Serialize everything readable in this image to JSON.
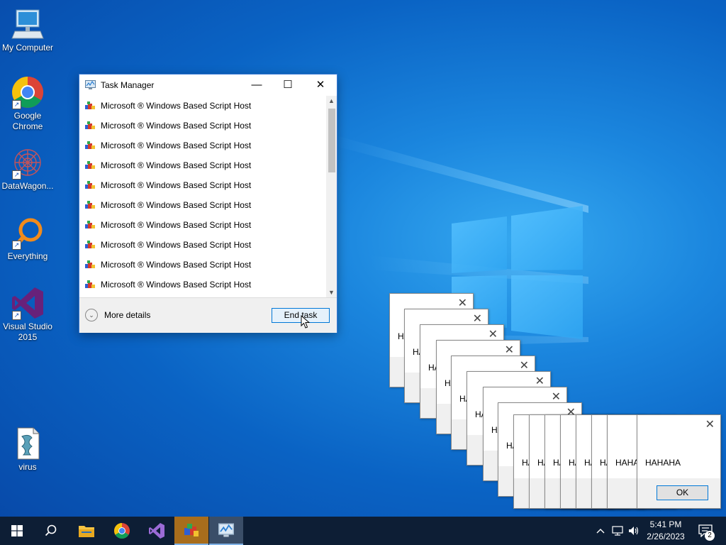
{
  "desktop": {
    "icons": [
      {
        "label": "My Computer"
      },
      {
        "label": "Google Chrome"
      },
      {
        "label": "DataWagon..."
      },
      {
        "label": "Everything"
      },
      {
        "label": "Visual Studio 2015"
      },
      {
        "label": "virus"
      }
    ]
  },
  "task_manager": {
    "title": "Task Manager",
    "processes": [
      "Microsoft ® Windows Based Script Host",
      "Microsoft ® Windows Based Script Host",
      "Microsoft ® Windows Based Script Host",
      "Microsoft ® Windows Based Script Host",
      "Microsoft ® Windows Based Script Host",
      "Microsoft ® Windows Based Script Host",
      "Microsoft ® Windows Based Script Host",
      "Microsoft ® Windows Based Script Host",
      "Microsoft ® Windows Based Script Host",
      "Microsoft ® Windows Based Script Host"
    ],
    "more_details": "More details",
    "end_task": "End task"
  },
  "message_boxes": {
    "partial_text": "HA",
    "full_text": "HAHAHA",
    "mid_text": "HAHA",
    "ok_label": "OK"
  },
  "taskbar": {
    "time": "5:41 PM",
    "date": "2/26/2023",
    "notification_count": "2"
  },
  "colors": {
    "accent": "#0078d7",
    "taskbar": "#0d1e35"
  }
}
